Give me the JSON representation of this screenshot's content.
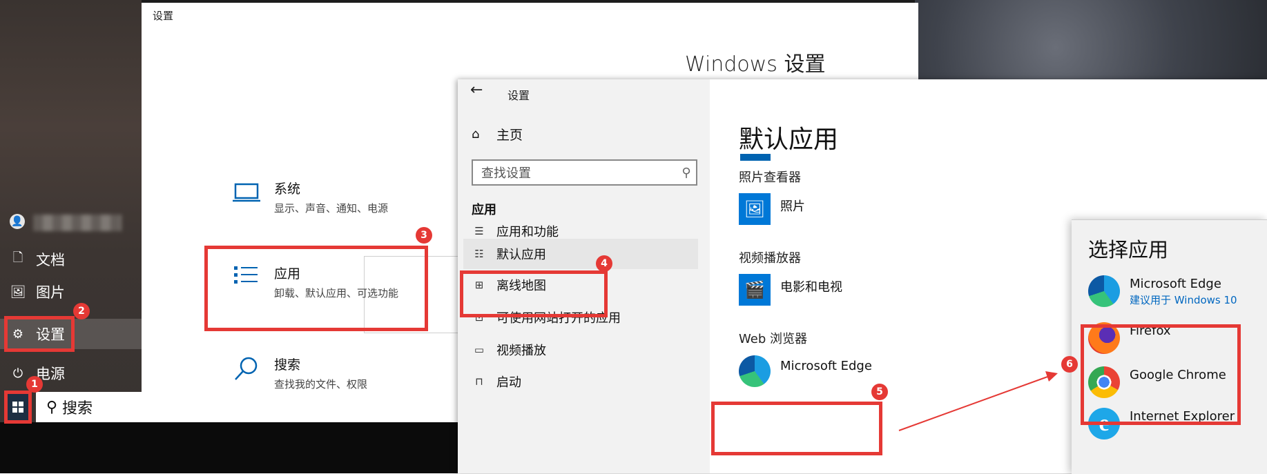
{
  "settings_window": {
    "title": "设置",
    "header": "Windows 设置",
    "categories": [
      {
        "title": "系统",
        "sub": "显示、声音、通知、电源"
      },
      {
        "title": "应用",
        "sub": "卸载、默认应用、可选功能"
      },
      {
        "title": "搜索",
        "sub": "查找我的文件、权限"
      }
    ]
  },
  "start_menu": {
    "items": [
      "文档",
      "图片",
      "设置",
      "电源"
    ],
    "search_text": "搜索"
  },
  "default_apps_window": {
    "title": "设置",
    "home": "主页",
    "search_placeholder": "查找设置",
    "section": "应用",
    "nav": [
      "应用和功能",
      "默认应用",
      "离线地图",
      "可使用网站打开的应用",
      "视频播放",
      "启动"
    ],
    "heading": "默认应用",
    "groups": [
      {
        "label": "照片查看器",
        "app": "照片"
      },
      {
        "label": "视频播放器",
        "app": "电影和电视"
      },
      {
        "label": "Web 浏览器",
        "app": "Microsoft Edge"
      }
    ]
  },
  "choose_app": {
    "title": "选择应用",
    "apps": [
      {
        "name": "Microsoft Edge",
        "sub": "建议用于 Windows 10"
      },
      {
        "name": "Firefox"
      },
      {
        "name": "Google Chrome"
      },
      {
        "name": "Internet Explorer"
      }
    ]
  },
  "badges": [
    "1",
    "2",
    "3",
    "4",
    "5",
    "6"
  ],
  "colors": {
    "accent": "#0078d7",
    "annotation": "#e53935"
  }
}
